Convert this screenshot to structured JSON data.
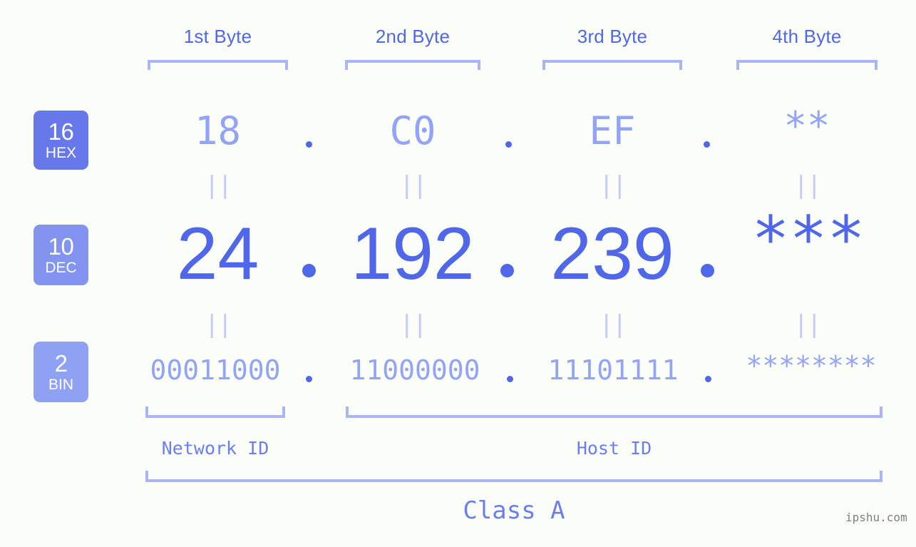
{
  "background_color": "#fbfdf8",
  "accent_color": "#4f67e8",
  "accent_light_color": "#93a3f5",
  "bracket_color": "#aab5f8",
  "byte_headers": [
    {
      "label": "1st Byte"
    },
    {
      "label": "2nd Byte"
    },
    {
      "label": "3rd Byte"
    },
    {
      "label": "4th Byte"
    }
  ],
  "bases": [
    {
      "num": "16",
      "name": "HEX",
      "color": "#6678ea"
    },
    {
      "num": "10",
      "name": "DEC",
      "color": "#8293f0"
    },
    {
      "num": "2",
      "name": "BIN",
      "color": "#8fa1f3"
    }
  ],
  "rows": {
    "hex": {
      "label": "HEX",
      "octets": [
        "18",
        "C0",
        "EF",
        "**"
      ]
    },
    "dec": {
      "label": "DEC",
      "octets": [
        "24",
        "192",
        "239",
        "***"
      ]
    },
    "bin": {
      "label": "BIN",
      "octets": [
        "00011000",
        "11000000",
        "11101111",
        "********"
      ]
    }
  },
  "separators": {
    "equals": "||",
    "dot": "."
  },
  "segments": {
    "network_id": "Network ID",
    "host_id": "Host ID",
    "class": "Class A"
  },
  "watermark": "ipshu.com"
}
